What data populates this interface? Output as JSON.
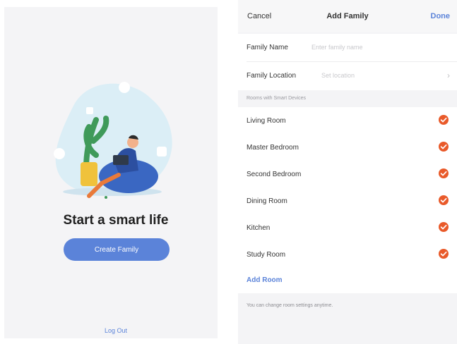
{
  "left": {
    "headline": "Start a smart life",
    "create_button": "Create Family",
    "logout": "Log Out"
  },
  "nav": {
    "cancel": "Cancel",
    "title": "Add Family",
    "done": "Done"
  },
  "form": {
    "family_name_label": "Family Name",
    "family_name_placeholder": "Enter family name",
    "family_location_label": "Family Location",
    "family_location_placeholder": "Set location"
  },
  "rooms_section_header": "Rooms with Smart Devices",
  "rooms": [
    {
      "label": "Living Room",
      "checked": true
    },
    {
      "label": "Master Bedroom",
      "checked": true
    },
    {
      "label": "Second Bedroom",
      "checked": true
    },
    {
      "label": "Dining Room",
      "checked": true
    },
    {
      "label": "Kitchen",
      "checked": true
    },
    {
      "label": "Study Room",
      "checked": true
    }
  ],
  "add_room": "Add Room",
  "footer_note": "You can change room settings anytime.",
  "colors": {
    "accent": "#5b83d9",
    "check": "#e95a2a",
    "background": "#f4f4f6"
  }
}
